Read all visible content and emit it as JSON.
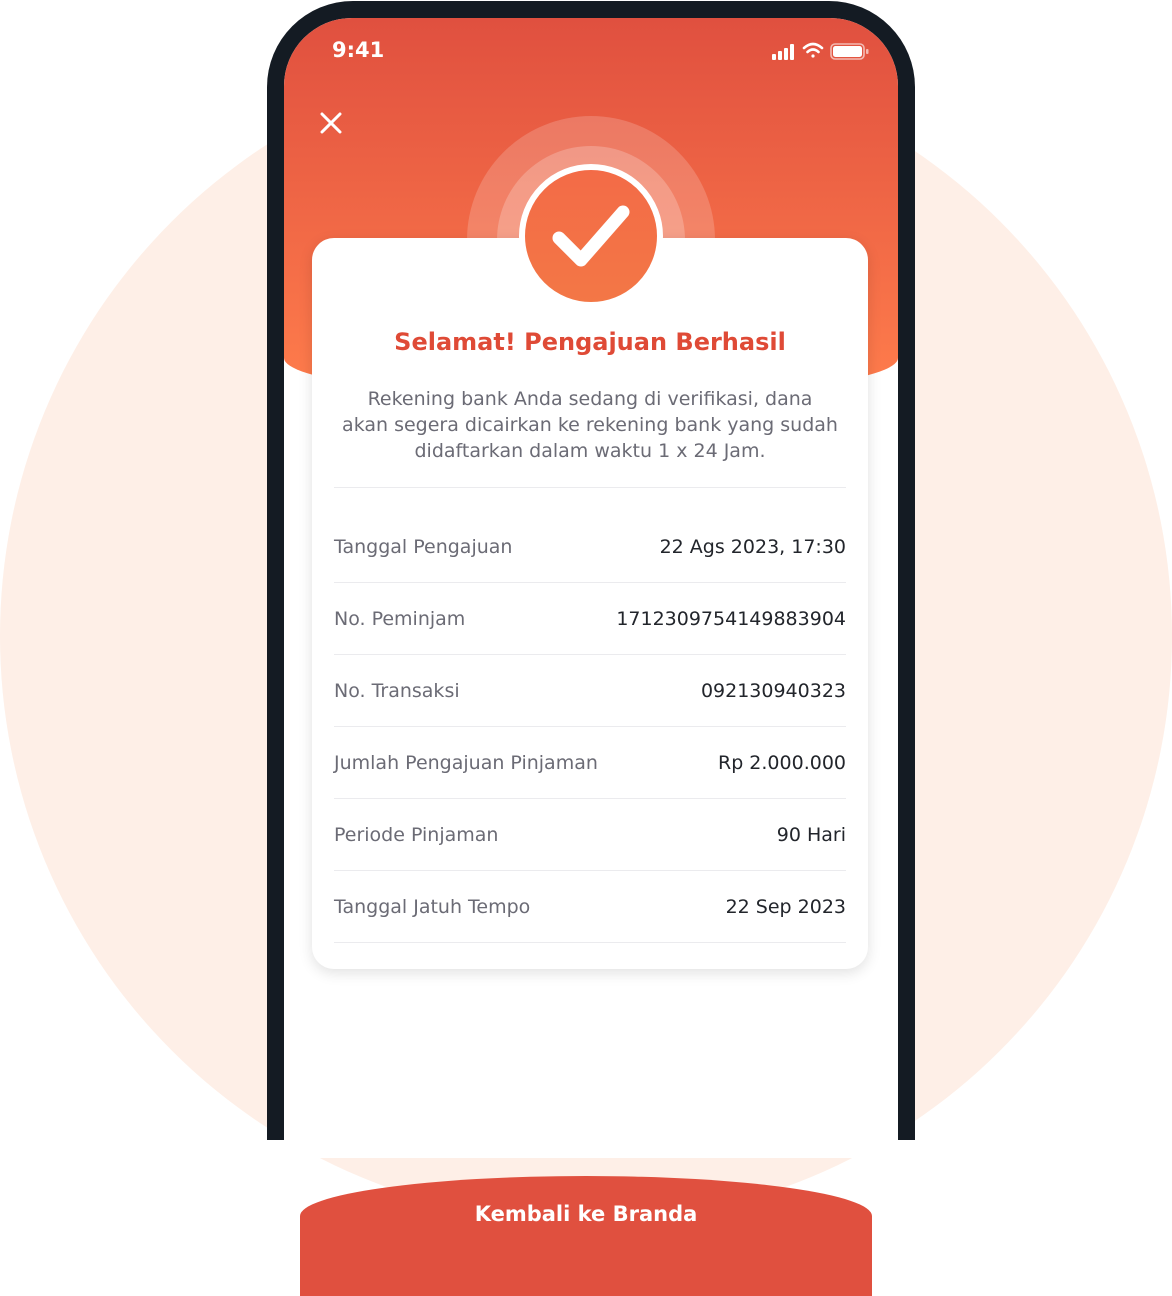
{
  "status_bar": {
    "time": "9:41"
  },
  "result": {
    "title": "Selamat! Pengajuan Berhasil",
    "description": "Rekening bank Anda sedang di verifikasi, dana akan segera dicairkan ke rekening bank yang sudah didaftarkan dalam waktu 1 x 24 Jam."
  },
  "details": [
    {
      "label": "Tanggal Pengajuan",
      "value": "22 Ags 2023, 17:30"
    },
    {
      "label": "No. Peminjam",
      "value": "1712309754149883904"
    },
    {
      "label": "No. Transaksi",
      "value": "092130940323"
    },
    {
      "label": "Jumlah Pengajuan Pinjaman",
      "value": "Rp 2.000.000"
    },
    {
      "label": "Periode Pinjaman",
      "value": "90 Hari"
    },
    {
      "label": "Tanggal Jatuh Tempo",
      "value": "22 Sep 2023"
    }
  ],
  "cta": {
    "label": "Kembali ke Branda"
  },
  "colors": {
    "accent": "#E0503F",
    "title": "#DF4A36",
    "background_circle": "#FEEFE7"
  }
}
